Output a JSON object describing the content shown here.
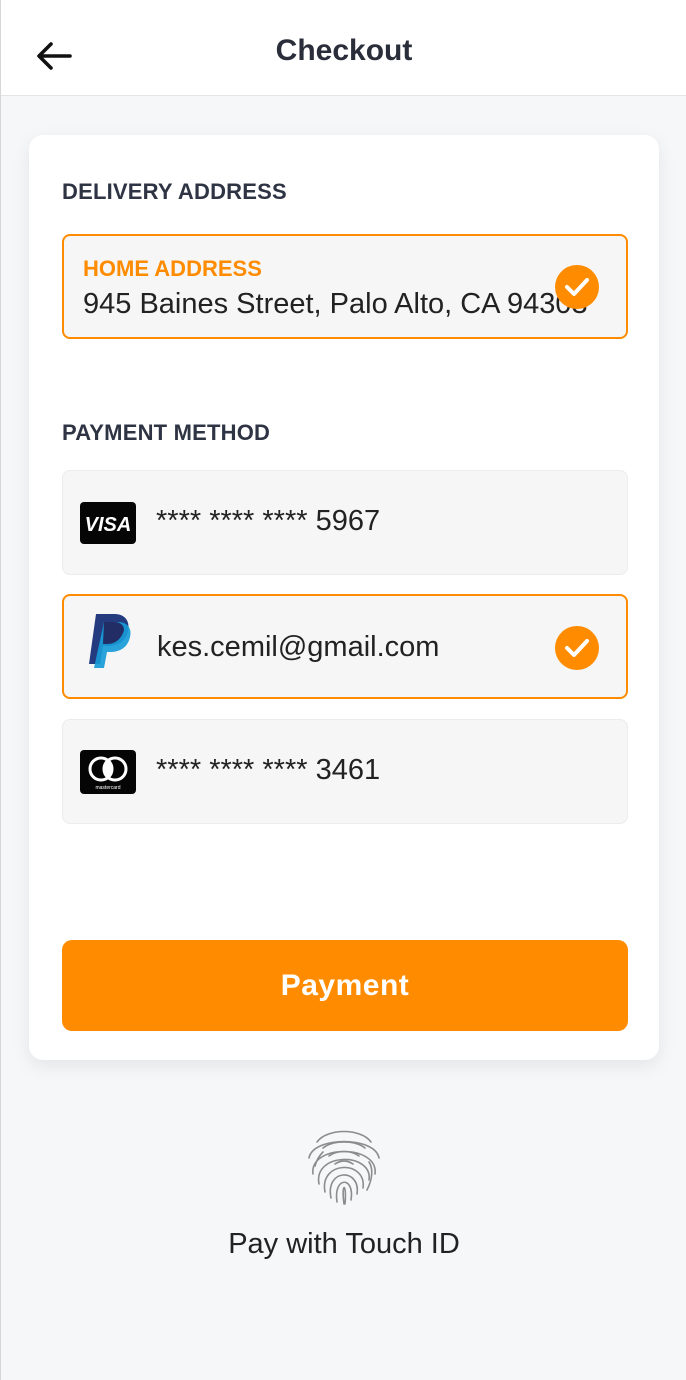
{
  "header": {
    "title": "Checkout",
    "back_icon": "arrow-left-icon"
  },
  "delivery": {
    "section_title": "DELIVERY ADDRESS",
    "address_label": "HOME ADDRESS",
    "address_value": "945 Baines Street, Palo Alto, CA 94303",
    "selected": true
  },
  "payment": {
    "section_title": "PAYMENT METHOD",
    "methods": [
      {
        "brand": "VISA",
        "logo_icon": "visa-logo-icon",
        "label": "**** **** **** 5967",
        "selected": false
      },
      {
        "brand": "PayPal",
        "logo_icon": "paypal-logo-icon",
        "label": "kes.cemil@gmail.com",
        "selected": true
      },
      {
        "brand": "mastercard",
        "logo_icon": "mastercard-logo-icon",
        "label": "**** **** **** 3461",
        "selected": false
      }
    ]
  },
  "actions": {
    "payment_button": "Payment",
    "touch_id_label": "Pay with Touch ID",
    "touch_id_icon": "fingerprint-icon"
  },
  "colors": {
    "accent": "#ff8c00",
    "heading": "#2f3444",
    "background": "#f6f7f9",
    "card": "#ffffff"
  }
}
